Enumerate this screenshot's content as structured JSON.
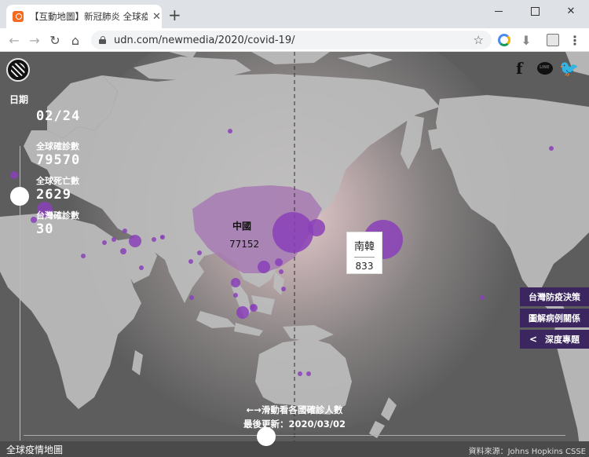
{
  "browser": {
    "tab_title": "【互動地圖】新冠肺炎 全球疫情",
    "url": "udn.com/newmedia/2020/covid-19/"
  },
  "sidebar": {
    "date_label": "日期",
    "date_value": "02/24",
    "global_cases_label": "全球確診數",
    "global_cases_value": "79570",
    "global_deaths_label": "全球死亡數",
    "global_deaths_value": "2629",
    "taiwan_cases_label": "台灣確診數",
    "taiwan_cases_value": "30"
  },
  "map": {
    "china_label": "中國",
    "china_value": "77152",
    "tooltip_name": "南韓",
    "tooltip_value": "833",
    "marker_color": "#8a3fb8"
  },
  "side_buttons": {
    "policy": "台灣防疫決策",
    "case_graph": "圖解病例關係",
    "feature": "深度專題"
  },
  "bottom": {
    "hint": "←→滑動看各國確診人數",
    "updated": "最後更新：2020/03/02"
  },
  "footer": {
    "title": "全球疫情地圖",
    "source": "資料來源：Johns Hopkins CSSE"
  }
}
